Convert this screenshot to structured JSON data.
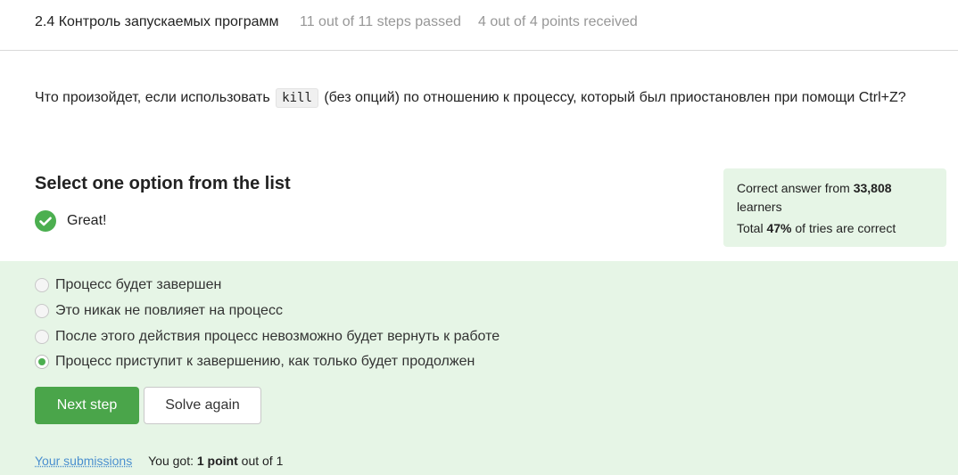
{
  "header": {
    "lesson_title": "2.4 Контроль запускаемых программ",
    "steps_passed": "11 out of 11 steps passed",
    "points_received": "4 out of 4 points  received"
  },
  "question": {
    "text_before": "Что произойдет, если использовать",
    "code": "kill",
    "text_after": "(без опций) по отношению к процессу, который был приостановлен при помощи Ctrl+Z?"
  },
  "quiz": {
    "section_title": "Select one option from the list",
    "status_text": "Great!",
    "options": [
      {
        "label": "Процесс будет завершен",
        "selected": false
      },
      {
        "label": "Это никак не повлияет на процесс",
        "selected": false
      },
      {
        "label": "После этого действия процесс невозможно будет вернуть к работе",
        "selected": false
      },
      {
        "label": "Процесс приступит к завершению, как только будет продолжен",
        "selected": true
      }
    ],
    "next_button": "Next step",
    "solve_again_button": "Solve again"
  },
  "stats": {
    "correct_prefix": "Correct answer from",
    "learners_count": "33,808",
    "learners_suffix": "learners",
    "total_prefix": "Total",
    "percent": "47%",
    "total_suffix": "of tries are correct"
  },
  "footer": {
    "submissions_link": "Your submissions",
    "you_got_prefix": "You got:",
    "points_bold": "1 point",
    "points_suffix": "out of 1"
  },
  "colors": {
    "accent_green": "#4aa54a",
    "success_bg": "#e6f5e6",
    "link_blue": "#4a8fcf"
  }
}
